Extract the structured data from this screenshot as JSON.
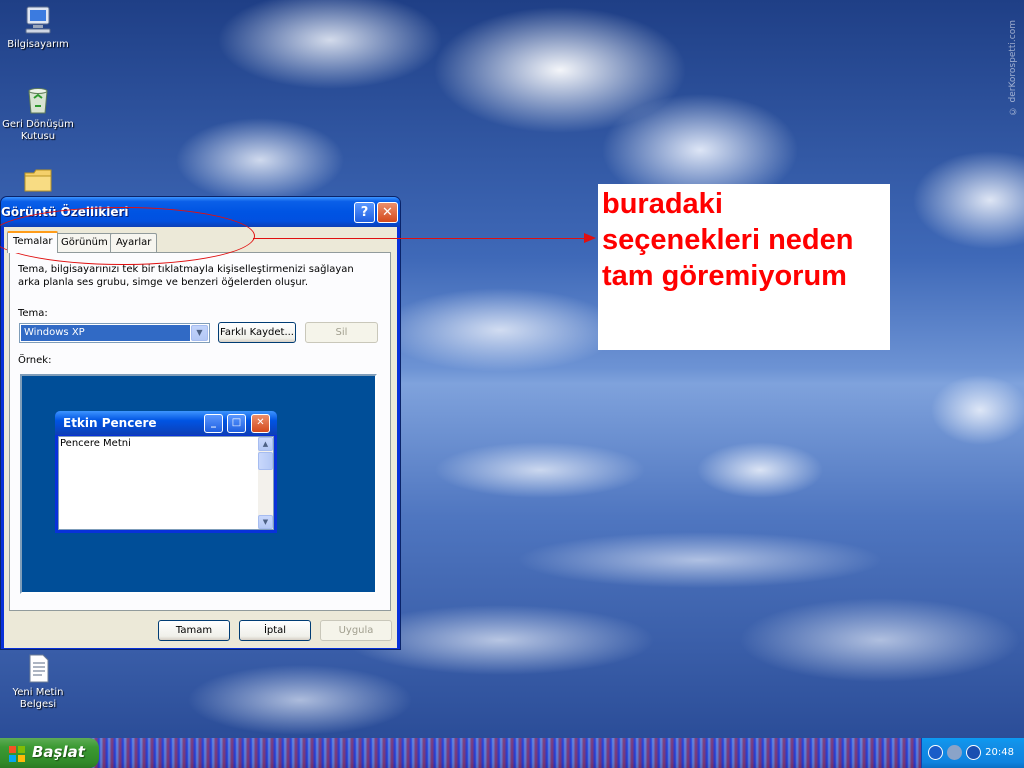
{
  "desktop": {
    "watermark": "© derKorospetti.com",
    "icons": [
      {
        "label": "Bilgisayarım",
        "icon": "computer-icon"
      },
      {
        "label": "Geri Dönüşüm Kutusu",
        "icon": "recycle-bin-icon"
      },
      {
        "label": "",
        "icon": "folder-icon"
      },
      {
        "label": "Yeni Metin Belgesi",
        "icon": "text-document-icon"
      }
    ]
  },
  "annotation": {
    "line1": "buradaki",
    "line2": "seçenekleri neden",
    "line3": "tam göremiyorum",
    "color": "#ff0000"
  },
  "dialog": {
    "title": "Görüntü Özellikleri",
    "help_button": "?",
    "close_button": "✕",
    "tabs": [
      {
        "label": "Temalar",
        "active": true
      },
      {
        "label": "Görünüm",
        "active": false
      },
      {
        "label": "Ayarlar",
        "active": false
      }
    ],
    "description": "Tema, bilgisayarınızı tek bir tıklatmayla kişiselleştirmenizi sağlayan arka planla ses grubu, simge ve benzeri öğelerden oluşur.",
    "theme_label": "Tema:",
    "theme_value": "Windows XP",
    "save_as_button": "Farklı Kaydet...",
    "delete_button": "Sil",
    "preview_label": "Örnek:",
    "preview_window": {
      "title": "Etkin Pencere",
      "body_text": "Pencere Metni"
    },
    "ok_button": "Tamam",
    "cancel_button": "İptal",
    "apply_button": "Uygula"
  },
  "taskbar": {
    "start_label": "Başlat",
    "clock": "20:48"
  }
}
